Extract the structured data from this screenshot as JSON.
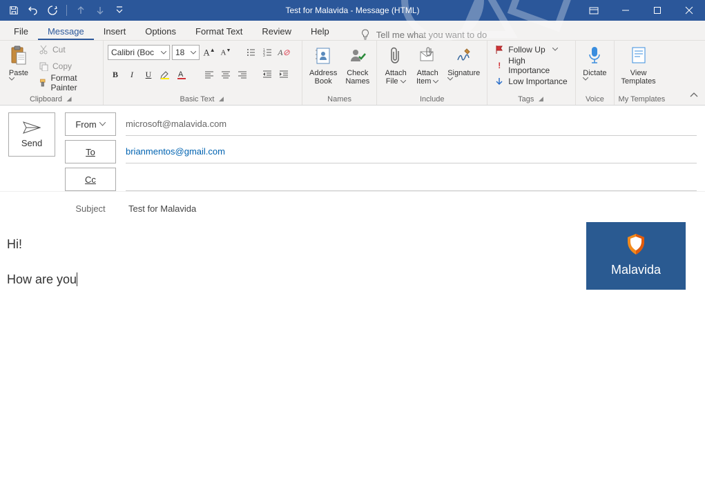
{
  "window": {
    "title": "Test for Malavida  -  Message (HTML)"
  },
  "tabs": {
    "file": "File",
    "message": "Message",
    "insert": "Insert",
    "options": "Options",
    "format": "Format Text",
    "review": "Review",
    "help": "Help",
    "tellme_placeholder": "Tell me what you want to do"
  },
  "ribbon": {
    "clipboard": {
      "label": "Clipboard",
      "paste": "Paste",
      "cut": "Cut",
      "copy": "Copy",
      "formatpainter": "Format Painter"
    },
    "basictext": {
      "label": "Basic Text",
      "font": "Calibri (Boc",
      "size": "18"
    },
    "names": {
      "label": "Names",
      "address": "Address\nBook",
      "check": "Check\nNames"
    },
    "include": {
      "label": "Include",
      "attachfile": "Attach\nFile",
      "attachitem": "Attach\nItem",
      "signature": "Signature"
    },
    "tags": {
      "label": "Tags",
      "followup": "Follow Up",
      "high": "High Importance",
      "low": "Low Importance"
    },
    "voice": {
      "label": "Voice",
      "dictate": "Dictate"
    },
    "mytemplates": {
      "label": "My Templates",
      "view": "View\nTemplates"
    }
  },
  "header": {
    "send": "Send",
    "from_btn": "From",
    "to_btn": "To",
    "cc_btn": "Cc",
    "subject_label": "Subject",
    "from_value": "microsoft@malavida.com",
    "to_value": "brianmentos@gmail.com",
    "cc_value": "",
    "subject_value": "Test for Malavida"
  },
  "body": {
    "line1": "Hi!",
    "line2": "How are you",
    "logo_text": "Malavida"
  }
}
